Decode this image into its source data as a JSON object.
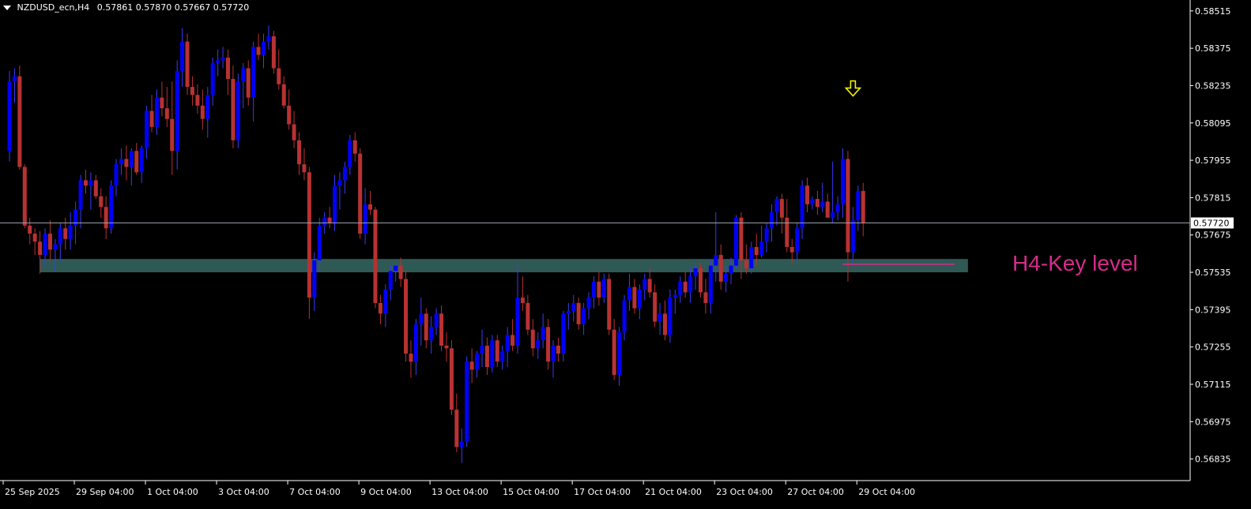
{
  "header": {
    "symbol": "NZDUSD_ecn,H4",
    "ohlc": "0.57861 0.57870 0.57667 0.57720"
  },
  "annotations": {
    "key_level_label": "H4-Key level",
    "current_price_label": "0.57720"
  },
  "colors": {
    "background": "#000000",
    "bull": "#0000ff",
    "bear": "#b83232",
    "wick_bull": "#3a3aff",
    "wick_bear": "#b83232",
    "zone": "#2f5955",
    "key_line": "#d62b8a",
    "arrow": "#f2f200",
    "axis": "#ffffff",
    "price_line": "#9aa0aa"
  },
  "chart_data": {
    "type": "candlestick",
    "timeframe": "H4",
    "ylim": [
      0.5676,
      0.5855
    ],
    "y_ticks": [
      "0.58515",
      "0.58375",
      "0.58235",
      "0.58095",
      "0.57955",
      "0.57815",
      "0.57675",
      "0.57535",
      "0.57395",
      "0.57255",
      "0.57115",
      "0.56975",
      "0.56835"
    ],
    "x_ticks": [
      "25 Sep 2025",
      "29 Sep 04:00",
      "1 Oct 04:00",
      "3 Oct 04:00",
      "7 Oct 04:00",
      "9 Oct 04:00",
      "13 Oct 04:00",
      "15 Oct 04:00",
      "17 Oct 04:00",
      "21 Oct 04:00",
      "23 Oct 04:00",
      "27 Oct 04:00",
      "29 Oct 04:00"
    ],
    "x_tick_index": [
      0,
      14,
      28,
      42,
      56,
      70,
      84,
      98,
      112,
      126,
      140,
      154,
      168
    ],
    "current_price": 0.5772,
    "key_zone": {
      "low": 0.57535,
      "high": 0.57585,
      "from_index": 6,
      "to_index": 188
    },
    "key_line": {
      "price": 0.57565,
      "from_index": 164,
      "to_index": 186
    },
    "arrow": {
      "index": 166,
      "price": 0.5822
    },
    "ohlc": [
      [
        0.5799,
        0.5829,
        0.5795,
        0.5825
      ],
      [
        0.5825,
        0.583,
        0.5817,
        0.5827
      ],
      [
        0.5827,
        0.5831,
        0.5792,
        0.5793
      ],
      [
        0.5793,
        0.5794,
        0.577,
        0.5771
      ],
      [
        0.5771,
        0.5774,
        0.5764,
        0.5768
      ],
      [
        0.5768,
        0.577,
        0.576,
        0.5765
      ],
      [
        0.5765,
        0.5769,
        0.5753,
        0.576
      ],
      [
        0.576,
        0.577,
        0.5756,
        0.5768
      ],
      [
        0.5768,
        0.5773,
        0.5758,
        0.5762
      ],
      [
        0.5762,
        0.5766,
        0.5754,
        0.5764
      ],
      [
        0.5764,
        0.5772,
        0.5758,
        0.577
      ],
      [
        0.577,
        0.5774,
        0.5762,
        0.5766
      ],
      [
        0.5766,
        0.5776,
        0.5762,
        0.5771
      ],
      [
        0.5771,
        0.578,
        0.5764,
        0.5777
      ],
      [
        0.5777,
        0.579,
        0.577,
        0.5788
      ],
      [
        0.5788,
        0.5792,
        0.5783,
        0.5786
      ],
      [
        0.5786,
        0.5791,
        0.5777,
        0.5788
      ],
      [
        0.5788,
        0.579,
        0.5781,
        0.5782
      ],
      [
        0.5782,
        0.5785,
        0.5774,
        0.5778
      ],
      [
        0.5778,
        0.5782,
        0.5766,
        0.577
      ],
      [
        0.577,
        0.5788,
        0.5768,
        0.5786
      ],
      [
        0.5786,
        0.5796,
        0.5782,
        0.5794
      ],
      [
        0.5794,
        0.58,
        0.579,
        0.5796
      ],
      [
        0.5796,
        0.5801,
        0.5788,
        0.5793
      ],
      [
        0.5793,
        0.58,
        0.5786,
        0.5799
      ],
      [
        0.5799,
        0.5802,
        0.579,
        0.5791
      ],
      [
        0.5791,
        0.5801,
        0.5787,
        0.58
      ],
      [
        0.58,
        0.5816,
        0.5796,
        0.5814
      ],
      [
        0.5814,
        0.582,
        0.5806,
        0.5808
      ],
      [
        0.5808,
        0.5822,
        0.5805,
        0.5819
      ],
      [
        0.5819,
        0.5825,
        0.5812,
        0.5815
      ],
      [
        0.5815,
        0.5823,
        0.5808,
        0.5811
      ],
      [
        0.5811,
        0.5825,
        0.579,
        0.5799
      ],
      [
        0.5799,
        0.5833,
        0.5792,
        0.5829
      ],
      [
        0.5829,
        0.5845,
        0.5823,
        0.584
      ],
      [
        0.584,
        0.5843,
        0.582,
        0.5823
      ],
      [
        0.5823,
        0.5827,
        0.5816,
        0.582
      ],
      [
        0.582,
        0.5824,
        0.5813,
        0.5816
      ],
      [
        0.5816,
        0.5822,
        0.5807,
        0.5811
      ],
      [
        0.5811,
        0.5823,
        0.5804,
        0.582
      ],
      [
        0.582,
        0.5834,
        0.5816,
        0.5832
      ],
      [
        0.5832,
        0.5837,
        0.5827,
        0.5833
      ],
      [
        0.5833,
        0.5838,
        0.583,
        0.5834
      ],
      [
        0.5834,
        0.5837,
        0.582,
        0.5826
      ],
      [
        0.5826,
        0.5831,
        0.58,
        0.5803
      ],
      [
        0.5803,
        0.5828,
        0.58,
        0.5825
      ],
      [
        0.5825,
        0.5832,
        0.5815,
        0.583
      ],
      [
        0.583,
        0.5833,
        0.5816,
        0.5819
      ],
      [
        0.5819,
        0.584,
        0.581,
        0.5838
      ],
      [
        0.5838,
        0.5843,
        0.5833,
        0.5835
      ],
      [
        0.5835,
        0.5843,
        0.583,
        0.584
      ],
      [
        0.584,
        0.5846,
        0.5837,
        0.5842
      ],
      [
        0.5842,
        0.5844,
        0.5828,
        0.583
      ],
      [
        0.583,
        0.5837,
        0.5822,
        0.5824
      ],
      [
        0.5824,
        0.5827,
        0.5815,
        0.5816
      ],
      [
        0.5816,
        0.5822,
        0.5807,
        0.5809
      ],
      [
        0.5809,
        0.5814,
        0.58,
        0.5803
      ],
      [
        0.5803,
        0.5806,
        0.579,
        0.5794
      ],
      [
        0.5794,
        0.58,
        0.5788,
        0.5791
      ],
      [
        0.5791,
        0.5793,
        0.5736,
        0.5744
      ],
      [
        0.5744,
        0.5761,
        0.5739,
        0.5758
      ],
      [
        0.5758,
        0.5774,
        0.5754,
        0.5771
      ],
      [
        0.5771,
        0.5776,
        0.5768,
        0.5774
      ],
      [
        0.5774,
        0.5778,
        0.577,
        0.5772
      ],
      [
        0.5772,
        0.579,
        0.5769,
        0.5786
      ],
      [
        0.5786,
        0.5791,
        0.5777,
        0.5788
      ],
      [
        0.5788,
        0.5795,
        0.5783,
        0.5793
      ],
      [
        0.5793,
        0.5805,
        0.579,
        0.5803
      ],
      [
        0.5803,
        0.5806,
        0.5795,
        0.5798
      ],
      [
        0.5798,
        0.58,
        0.5766,
        0.5768
      ],
      [
        0.5768,
        0.5785,
        0.5764,
        0.5779
      ],
      [
        0.5779,
        0.5784,
        0.5775,
        0.5777
      ],
      [
        0.5777,
        0.5778,
        0.574,
        0.5742
      ],
      [
        0.5742,
        0.5745,
        0.5734,
        0.5738
      ],
      [
        0.5738,
        0.5749,
        0.5733,
        0.5747
      ],
      [
        0.5747,
        0.5756,
        0.5743,
        0.5754
      ],
      [
        0.5754,
        0.5758,
        0.575,
        0.5756
      ],
      [
        0.5756,
        0.5759,
        0.5748,
        0.5751
      ],
      [
        0.5751,
        0.5754,
        0.572,
        0.5723
      ],
      [
        0.5723,
        0.5728,
        0.5714,
        0.572
      ],
      [
        0.572,
        0.5736,
        0.5715,
        0.5734
      ],
      [
        0.5734,
        0.5744,
        0.5726,
        0.5738
      ],
      [
        0.5738,
        0.574,
        0.5725,
        0.5728
      ],
      [
        0.5728,
        0.5737,
        0.5723,
        0.5733
      ],
      [
        0.5733,
        0.574,
        0.573,
        0.5738
      ],
      [
        0.5738,
        0.5741,
        0.5724,
        0.5726
      ],
      [
        0.5726,
        0.5731,
        0.572,
        0.5725
      ],
      [
        0.5725,
        0.5728,
        0.57,
        0.5702
      ],
      [
        0.5702,
        0.5708,
        0.5686,
        0.5688
      ],
      [
        0.5688,
        0.5695,
        0.5682,
        0.569
      ],
      [
        0.569,
        0.5722,
        0.5688,
        0.572
      ],
      [
        0.572,
        0.5725,
        0.5712,
        0.5717
      ],
      [
        0.5717,
        0.5724,
        0.5714,
        0.5723
      ],
      [
        0.5723,
        0.5732,
        0.5718,
        0.5726
      ],
      [
        0.5726,
        0.5729,
        0.5715,
        0.5718
      ],
      [
        0.5718,
        0.573,
        0.5716,
        0.5728
      ],
      [
        0.5728,
        0.573,
        0.5718,
        0.572
      ],
      [
        0.572,
        0.5726,
        0.5717,
        0.5724
      ],
      [
        0.5724,
        0.5733,
        0.5718,
        0.573
      ],
      [
        0.573,
        0.5736,
        0.5724,
        0.5726
      ],
      [
        0.5726,
        0.5756,
        0.5723,
        0.5744
      ],
      [
        0.5744,
        0.5752,
        0.5739,
        0.5742
      ],
      [
        0.5742,
        0.5745,
        0.573,
        0.5732
      ],
      [
        0.5732,
        0.5736,
        0.5722,
        0.5725
      ],
      [
        0.5725,
        0.5731,
        0.5721,
        0.5728
      ],
      [
        0.5728,
        0.5738,
        0.5725,
        0.5733
      ],
      [
        0.5733,
        0.5736,
        0.5717,
        0.572
      ],
      [
        0.572,
        0.5728,
        0.5714,
        0.5726
      ],
      [
        0.5726,
        0.5729,
        0.572,
        0.5723
      ],
      [
        0.5723,
        0.5739,
        0.572,
        0.5738
      ],
      [
        0.5738,
        0.5742,
        0.5732,
        0.5739
      ],
      [
        0.5739,
        0.5745,
        0.5735,
        0.5742
      ],
      [
        0.5742,
        0.5744,
        0.5732,
        0.5734
      ],
      [
        0.5734,
        0.5742,
        0.573,
        0.574
      ],
      [
        0.574,
        0.5746,
        0.5736,
        0.5744
      ],
      [
        0.5744,
        0.5752,
        0.574,
        0.575
      ],
      [
        0.575,
        0.5754,
        0.5741,
        0.5744
      ],
      [
        0.5744,
        0.5753,
        0.5742,
        0.5751
      ],
      [
        0.5751,
        0.5753,
        0.573,
        0.5732
      ],
      [
        0.5732,
        0.5736,
        0.5713,
        0.5715
      ],
      [
        0.5715,
        0.5733,
        0.5711,
        0.5731
      ],
      [
        0.5731,
        0.5745,
        0.5728,
        0.5743
      ],
      [
        0.5743,
        0.5753,
        0.5739,
        0.5748
      ],
      [
        0.5748,
        0.5751,
        0.5738,
        0.574
      ],
      [
        0.574,
        0.5749,
        0.5736,
        0.5747
      ],
      [
        0.5747,
        0.5753,
        0.5743,
        0.5751
      ],
      [
        0.5751,
        0.5755,
        0.5744,
        0.5746
      ],
      [
        0.5746,
        0.5749,
        0.5733,
        0.5735
      ],
      [
        0.5735,
        0.5742,
        0.573,
        0.5738
      ],
      [
        0.5738,
        0.5743,
        0.5728,
        0.573
      ],
      [
        0.573,
        0.5747,
        0.5727,
        0.5744
      ],
      [
        0.5744,
        0.5747,
        0.5738,
        0.5745
      ],
      [
        0.5745,
        0.5752,
        0.5742,
        0.575
      ],
      [
        0.575,
        0.5754,
        0.5744,
        0.5746
      ],
      [
        0.5746,
        0.5755,
        0.5742,
        0.5752
      ],
      [
        0.5752,
        0.5757,
        0.5747,
        0.5755
      ],
      [
        0.5755,
        0.5757,
        0.5744,
        0.5746
      ],
      [
        0.5746,
        0.5751,
        0.5738,
        0.5742
      ],
      [
        0.5742,
        0.5758,
        0.5738,
        0.5756
      ],
      [
        0.5756,
        0.5776,
        0.575,
        0.576
      ],
      [
        0.576,
        0.5764,
        0.5747,
        0.575
      ],
      [
        0.575,
        0.5756,
        0.5746,
        0.5753
      ],
      [
        0.5753,
        0.5759,
        0.5749,
        0.5756
      ],
      [
        0.5756,
        0.5775,
        0.5755,
        0.5774
      ],
      [
        0.5774,
        0.5776,
        0.5751,
        0.5758
      ],
      [
        0.5758,
        0.5764,
        0.5753,
        0.5755
      ],
      [
        0.5755,
        0.5765,
        0.5753,
        0.5763
      ],
      [
        0.5763,
        0.5768,
        0.5756,
        0.576
      ],
      [
        0.576,
        0.5771,
        0.5759,
        0.5765
      ],
      [
        0.5765,
        0.5772,
        0.5761,
        0.577
      ],
      [
        0.577,
        0.5779,
        0.5765,
        0.5776
      ],
      [
        0.5776,
        0.5782,
        0.5771,
        0.5781
      ],
      [
        0.5781,
        0.5783,
        0.5768,
        0.5774
      ],
      [
        0.5774,
        0.5781,
        0.5761,
        0.5763
      ],
      [
        0.5763,
        0.5766,
        0.5757,
        0.5761
      ],
      [
        0.5761,
        0.5772,
        0.5758,
        0.577
      ],
      [
        0.577,
        0.5788,
        0.5766,
        0.5786
      ],
      [
        0.5786,
        0.5789,
        0.5776,
        0.5779
      ],
      [
        0.5779,
        0.5782,
        0.5777,
        0.5781
      ],
      [
        0.5781,
        0.5784,
        0.5775,
        0.5778
      ],
      [
        0.5778,
        0.5787,
        0.5776,
        0.578
      ],
      [
        0.578,
        0.5783,
        0.5774,
        0.5774
      ],
      [
        0.5774,
        0.5795,
        0.5772,
        0.5776
      ],
      [
        0.5776,
        0.5782,
        0.5773,
        0.5779
      ],
      [
        0.5779,
        0.58,
        0.5774,
        0.5796
      ],
      [
        0.5796,
        0.5799,
        0.575,
        0.5761
      ],
      [
        0.5761,
        0.5778,
        0.5757,
        0.5773
      ],
      [
        0.5773,
        0.5786,
        0.5769,
        0.5784
      ],
      [
        0.5784,
        0.5787,
        0.5767,
        0.5772
      ]
    ]
  }
}
